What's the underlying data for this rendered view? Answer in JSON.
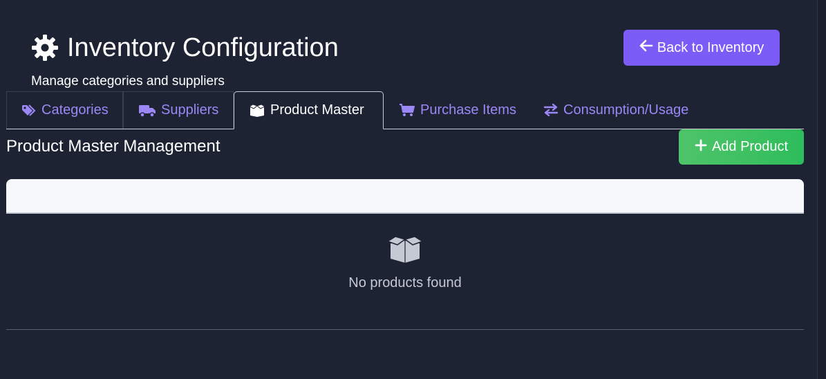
{
  "header": {
    "title": "Inventory Configuration",
    "title_icon": "gear-icon",
    "subtitle": "Manage categories and suppliers",
    "back_button": {
      "label": "Back to Inventory",
      "icon": "arrow-left-icon"
    }
  },
  "tabs": [
    {
      "label": "Categories",
      "icon": "tags-icon",
      "active": false
    },
    {
      "label": "Suppliers",
      "icon": "truck-icon",
      "active": false
    },
    {
      "label": "Product Master",
      "icon": "box-open-icon",
      "active": true
    },
    {
      "label": "Purchase Items",
      "icon": "cart-icon",
      "active": false
    },
    {
      "label": "Consumption/Usage",
      "icon": "exchange-icon",
      "active": false
    }
  ],
  "section": {
    "title": "Product Master Management",
    "add_button": {
      "label": "Add Product",
      "icon": "plus-icon"
    }
  },
  "empty_state": {
    "icon": "box-open-icon",
    "message": "No products found"
  },
  "colors": {
    "background": "#1e2334",
    "accent_purple": "#7c5cf7",
    "tab_text": "#9b87f5",
    "add_green": "#3ec163"
  }
}
